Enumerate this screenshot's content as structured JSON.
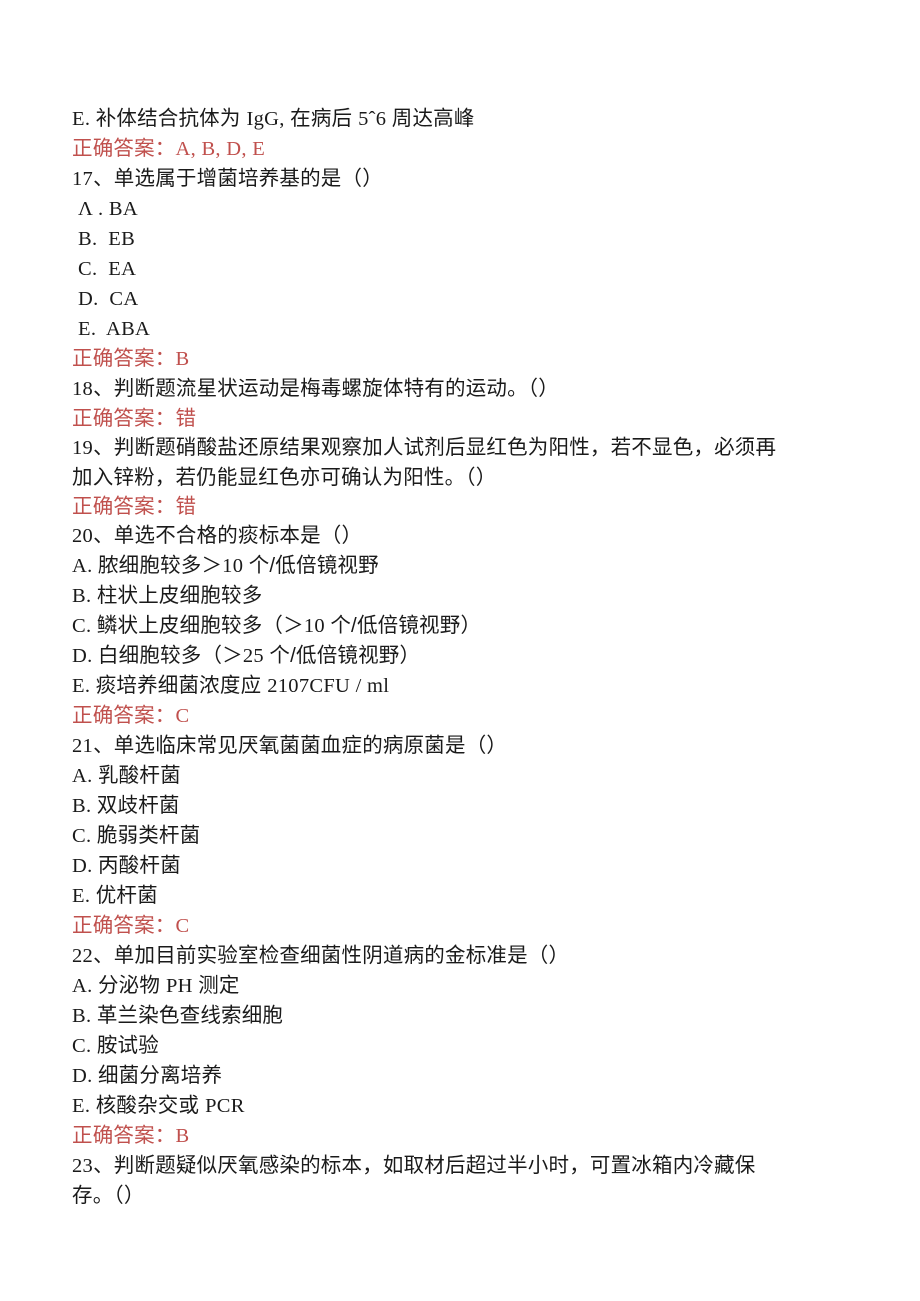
{
  "document": {
    "body_color": "#1a1a1a",
    "answer_color": "#c0504d",
    "answer_label": "正确答案：",
    "lines": [
      {
        "id": "q16-option-e",
        "kind": "option",
        "style": "compact",
        "text": "E. 补体结合抗体为 IgG, 在病后 5ˆ6 周达高峰"
      },
      {
        "id": "q16-answer",
        "kind": "answer",
        "text": "正确答案：A, B, D, E"
      },
      {
        "id": "q17-stem",
        "kind": "question",
        "text": "17、单选属于增菌培养基的是（）"
      },
      {
        "id": "q17-option-a",
        "kind": "option",
        "style": "spaced",
        "text": "Λ . BA"
      },
      {
        "id": "q17-option-b",
        "kind": "option",
        "style": "spaced",
        "text": "B.  EB"
      },
      {
        "id": "q17-option-c",
        "kind": "option",
        "style": "spaced",
        "text": "C.  EA"
      },
      {
        "id": "q17-option-d",
        "kind": "option",
        "style": "spaced",
        "text": "D.  CA"
      },
      {
        "id": "q17-option-e",
        "kind": "option",
        "style": "spaced",
        "text": "E.  ABA"
      },
      {
        "id": "q17-answer",
        "kind": "answer",
        "text": "正确答案：B"
      },
      {
        "id": "q18-stem",
        "kind": "question",
        "text": "18、判断题流星状运动是梅毒螺旋体特有的运动。（）"
      },
      {
        "id": "q18-answer",
        "kind": "answer",
        "text": "正确答案：错"
      },
      {
        "id": "q19-stem-line1",
        "kind": "question",
        "text": "19、判断题硝酸盐还原结果观察加人试剂后显红色为阳性，若不显色，必须再"
      },
      {
        "id": "q19-stem-line2",
        "kind": "question",
        "text": "加入锌粉，若仍能显红色亦可确认为阳性。（）"
      },
      {
        "id": "q19-answer",
        "kind": "answer",
        "text": "正确答案：错"
      },
      {
        "id": "q20-stem",
        "kind": "question",
        "text": "20、单选不合格的痰标本是（）"
      },
      {
        "id": "q20-option-a",
        "kind": "option",
        "style": "compact",
        "text": "A. 脓细胞较多＞10 个/低倍镜视野"
      },
      {
        "id": "q20-option-b",
        "kind": "option",
        "style": "compact",
        "text": "B. 柱状上皮细胞较多"
      },
      {
        "id": "q20-option-c",
        "kind": "option",
        "style": "compact",
        "text": "C. 鳞状上皮细胞较多（＞10 个/低倍镜视野）"
      },
      {
        "id": "q20-option-d",
        "kind": "option",
        "style": "compact",
        "text": "D. 白细胞较多（＞25 个/低倍镜视野）"
      },
      {
        "id": "q20-option-e",
        "kind": "option",
        "style": "compact",
        "text": "E. 痰培养细菌浓度应 2107CFU / ml"
      },
      {
        "id": "q20-answer",
        "kind": "answer",
        "text": "正确答案：C"
      },
      {
        "id": "q21-stem",
        "kind": "question",
        "text": "21、单选临床常见厌氧菌菌血症的病原菌是（）"
      },
      {
        "id": "q21-option-a",
        "kind": "option",
        "style": "compact",
        "text": "A. 乳酸杆菌"
      },
      {
        "id": "q21-option-b",
        "kind": "option",
        "style": "compact",
        "text": "B. 双歧杆菌"
      },
      {
        "id": "q21-option-c",
        "kind": "option",
        "style": "compact",
        "text": "C. 脆弱类杆菌"
      },
      {
        "id": "q21-option-d",
        "kind": "option",
        "style": "compact",
        "text": "D. 丙酸杆菌"
      },
      {
        "id": "q21-option-e",
        "kind": "option",
        "style": "compact",
        "text": "E. 优杆菌"
      },
      {
        "id": "q21-answer",
        "kind": "answer",
        "text": "正确答案：C"
      },
      {
        "id": "q22-stem",
        "kind": "question",
        "text": "22、单加目前实验室检查细菌性阴道病的金标准是（）"
      },
      {
        "id": "q22-option-a",
        "kind": "option",
        "style": "compact",
        "text": "A. 分泌物 PH 测定"
      },
      {
        "id": "q22-option-b",
        "kind": "option",
        "style": "compact",
        "text": "B. 革兰染色查线索细胞"
      },
      {
        "id": "q22-option-c",
        "kind": "option",
        "style": "compact",
        "text": "C. 胺试验"
      },
      {
        "id": "q22-option-d",
        "kind": "option",
        "style": "compact",
        "text": "D. 细菌分离培养"
      },
      {
        "id": "q22-option-e",
        "kind": "option",
        "style": "compact",
        "text": "E. 核酸杂交或 PCR"
      },
      {
        "id": "q22-answer",
        "kind": "answer",
        "text": "正确答案：B"
      },
      {
        "id": "q23-stem-line1",
        "kind": "question",
        "text": "23、判断题疑似厌氧感染的标本，如取材后超过半小时，可置冰箱内冷藏保"
      },
      {
        "id": "q23-stem-line2",
        "kind": "question",
        "text": "存。（）"
      }
    ]
  }
}
